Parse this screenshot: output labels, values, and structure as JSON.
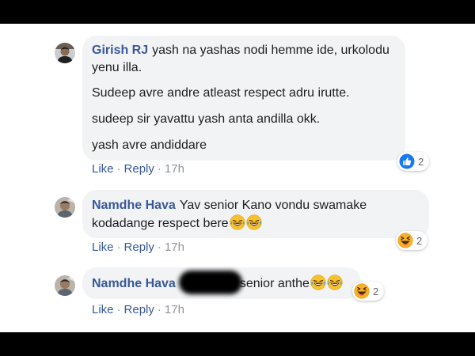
{
  "comments": [
    {
      "author": "Girish RJ",
      "paragraphs": [
        "yash na yashas nodi hemme ide, urkolodu yenu illa.",
        "Sudeep avre andre atleast respect adru irutte.",
        "sudeep sir yavattu yash anta andilla okk.",
        "yash avre andiddare"
      ],
      "actions": {
        "like": "Like",
        "reply": "Reply",
        "time": "17h"
      },
      "reaction": {
        "type": "like-icon",
        "count": "2"
      }
    },
    {
      "author": "Namdhe Hava",
      "text": "Yav senior Kano vondu swamake kodadange respect bere",
      "emoji_suffix": [
        "laughing-tears-icon",
        "laughing-tears-icon"
      ],
      "actions": {
        "like": "Like",
        "reply": "Reply",
        "time": "17h"
      },
      "reaction": {
        "type": "haha-icon",
        "count": "2"
      }
    },
    {
      "author": "Namdhe Hava",
      "text": "senior anthe",
      "emoji_suffix": [
        "laughing-tears-icon",
        "laughing-tears-icon"
      ],
      "actions": {
        "like": "Like",
        "reply": "Reply",
        "time": "17h"
      },
      "reaction": {
        "type": "haha-icon",
        "count": "2"
      }
    }
  ],
  "colors": {
    "name": "#385898",
    "bubble": "#f2f3f5",
    "meta": "#90949c",
    "like_blue": "#1877f2",
    "emoji_yellow": "#f7b125"
  }
}
